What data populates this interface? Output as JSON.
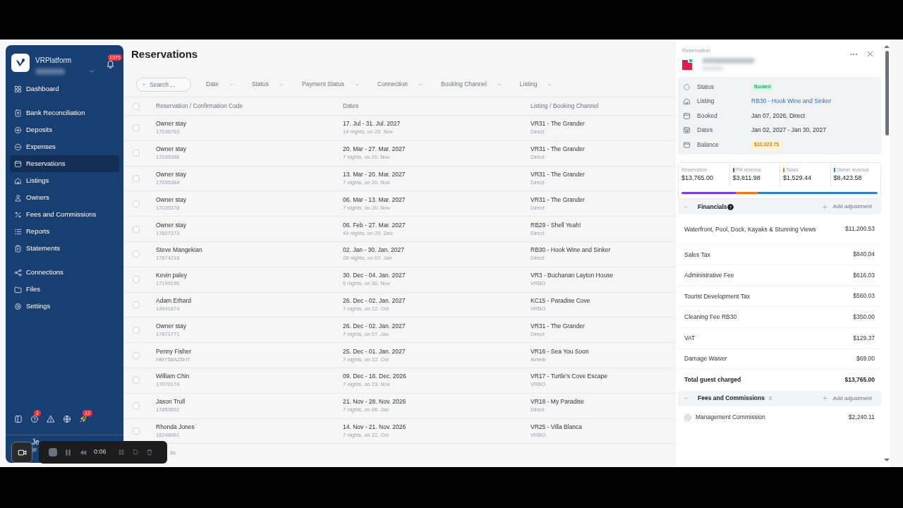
{
  "sidebar": {
    "brand": "VRPlatform",
    "notification_count": "1975",
    "groups": [
      [
        {
          "label": "Dashboard",
          "kind": "grid",
          "selected": false
        }
      ],
      [
        {
          "label": "Bank Reconciliation",
          "kind": "bank",
          "selected": false
        },
        {
          "label": "Deposits",
          "kind": "plus",
          "selected": false
        },
        {
          "label": "Expenses",
          "kind": "minus",
          "selected": false
        },
        {
          "label": "Reservations",
          "kind": "calendar",
          "selected": true
        },
        {
          "label": "Listings",
          "kind": "home",
          "selected": false
        },
        {
          "label": "Owners",
          "kind": "user",
          "selected": false
        },
        {
          "label": "Fees and Commissions",
          "kind": "percent",
          "selected": false
        },
        {
          "label": "Reports",
          "kind": "list",
          "selected": false
        },
        {
          "label": "Statements",
          "kind": "clipboard",
          "selected": false
        }
      ],
      [
        {
          "label": "Connections",
          "kind": "share",
          "selected": false
        },
        {
          "label": "Files",
          "kind": "folder",
          "selected": false
        },
        {
          "label": "Settings",
          "kind": "gear",
          "selected": false
        }
      ]
    ],
    "footer_icons": [
      {
        "kind": "panel"
      },
      {
        "kind": "help",
        "badge": "2"
      },
      {
        "kind": "alert"
      },
      {
        "kind": "globe"
      },
      {
        "kind": "rocket",
        "badge": "12"
      }
    ],
    "user": {
      "name": "Je",
      "email": "je"
    }
  },
  "page": {
    "title": "Reservations",
    "search": {
      "placeholder": "Search ..."
    },
    "filters": [
      "Date",
      "Status",
      "Payment Status",
      "Connection",
      "Booking Channel",
      "Listing"
    ],
    "select_all_checked": false,
    "columns": [
      "Reservation / Confirmation Code",
      "Dates",
      "Listing / Booking Channel"
    ],
    "rows": [
      {
        "name": "Owner stay",
        "code": "17036763",
        "dates": "17. Jul - 31. Jul. 2027",
        "nights": "14 nights, on 20. Nov",
        "listing": "VR31 - The Grander",
        "channel": "Direct",
        "checked": false
      },
      {
        "name": "Owner stay",
        "code": "17035386",
        "dates": "20. Mar - 27. Mar. 2027",
        "nights": "7 nights, on 20. Nov",
        "listing": "VR31 - The Grander",
        "channel": "Direct",
        "checked": false
      },
      {
        "name": "Owner stay",
        "code": "17035384",
        "dates": "13. Mar - 20. Mar. 2027",
        "nights": "7 nights, on 20. Nov",
        "listing": "VR31 - The Grander",
        "channel": "Direct",
        "checked": false
      },
      {
        "name": "Owner stay",
        "code": "17035378",
        "dates": "06. Mar - 13. Mar. 2027",
        "nights": "7 nights, on 20. Nov",
        "listing": "VR31 - The Grander",
        "channel": "Direct",
        "checked": false
      },
      {
        "name": "Owner stay",
        "code": "17607373",
        "dates": "06. Feb - 27. Mar. 2027",
        "nights": "49 nights, on 20. Dec",
        "listing": "RB29 - Shell Yeah!",
        "channel": "Direct",
        "checked": false
      },
      {
        "name": "Steve Mangekian",
        "code": "17874218",
        "dates": "02. Jan - 30. Jan. 2027",
        "nights": "28 nights, on 07. Jan",
        "listing": "RB30 - Hook Wine and Sinker",
        "channel": "Direct",
        "checked": false
      },
      {
        "name": "Kevin paley",
        "code": "17199190",
        "dates": "30. Dec - 04. Jan. 2027",
        "nights": "5 nights, on 30. Nov",
        "listing": "VR3 - Buchanan Layton House",
        "channel": "VRBO",
        "checked": false
      },
      {
        "name": "Adam Erhard",
        "code": "14941874",
        "dates": "26. Dec - 02. Jan. 2027",
        "nights": "7 nights, on 22. Oct",
        "listing": "KC15 - Paradise Cove",
        "channel": "VRBO",
        "checked": false
      },
      {
        "name": "Owner stay",
        "code": "17871771",
        "dates": "26. Dec - 02. Jan. 2027",
        "nights": "7 nights, on 07. Jan",
        "listing": "VR31 - The Grander",
        "channel": "Direct",
        "checked": false
      },
      {
        "name": "Penny Fisher",
        "code": "HMY58AZ5HT",
        "dates": "25. Dec - 01. Jan. 2027",
        "nights": "7 nights, on 22. Oct",
        "listing": "VR16 - Sea You Soon",
        "channel": "Airbnb",
        "checked": false
      },
      {
        "name": "William Chin",
        "code": "17070174",
        "dates": "09. Dec - 16. Dec. 2026",
        "nights": "7 nights, on 23. Nov",
        "listing": "VR17 - Turtle's Cove Escape",
        "channel": "VRBO",
        "checked": false
      },
      {
        "name": "Jason Trull",
        "code": "17853592",
        "dates": "21. Nov - 28. Nov. 2026",
        "nights": "7 nights, on 06. Jan",
        "listing": "VR18 - My Paradise",
        "channel": "Direct",
        "checked": false
      },
      {
        "name": "Rhonda Jones",
        "code": "16248961",
        "dates": "14. Nov - 21. Nov. 2026",
        "nights": "7 nights, on 22. Oct",
        "listing": "VR25 - Villa Blanca",
        "channel": "VRBO",
        "checked": false
      }
    ],
    "footer": "lts"
  },
  "recorder": {
    "time": "0:06"
  },
  "panel": {
    "label": "Reservation",
    "details": [
      {
        "label": "Status",
        "value": "Booked",
        "kind": "green_badge"
      },
      {
        "label": "Listing",
        "value": "RB30 - Hook Wine and Sinker",
        "kind": "link"
      },
      {
        "label": "Booked",
        "value": "Jan 07, 2026, Direct",
        "kind": "text"
      },
      {
        "label": "Dates",
        "value": "Jan 02, 2027 - Jan 30, 2027",
        "kind": "text"
      },
      {
        "label": "Balance",
        "value": "$10,323.75",
        "kind": "yellow_badge"
      }
    ],
    "stats": [
      {
        "label": "Reservation",
        "value": "$13,765.00"
      },
      {
        "label": "PM revenue",
        "value": "$3,811.98",
        "color": "#7c3aed"
      },
      {
        "label": "Taxes",
        "value": "$1,529.44",
        "color": "#f97316"
      },
      {
        "label": "Owner revenue",
        "value": "$8,423.58",
        "color": "#2f80d1"
      }
    ],
    "financials": {
      "title": "Financials",
      "action": "Add adjustment",
      "expanded": true,
      "items": [
        {
          "label": "Waterfront, Pool, Dock, Kayaks & Stunning Views",
          "value": "$11,200.53"
        },
        {
          "label": "Sales Tax",
          "value": "$840.04"
        },
        {
          "label": "Administrative Fee",
          "value": "$616.03"
        },
        {
          "label": "Tourist Development Tax",
          "value": "$560.03"
        },
        {
          "label": "Cleaning Fee RB30",
          "value": "$350.00"
        },
        {
          "label": "VAT",
          "value": "$129.37"
        },
        {
          "label": "Damage Waiver",
          "value": "$69.00"
        }
      ],
      "total_label": "Total guest charged",
      "total_value": "$13,765.00"
    },
    "fees": {
      "title": "Fees and Commissions",
      "count": "8",
      "action": "Add adjustment",
      "expanded": true,
      "items": [
        {
          "label": "Management Commission",
          "value": "$2,240.11"
        }
      ]
    }
  }
}
